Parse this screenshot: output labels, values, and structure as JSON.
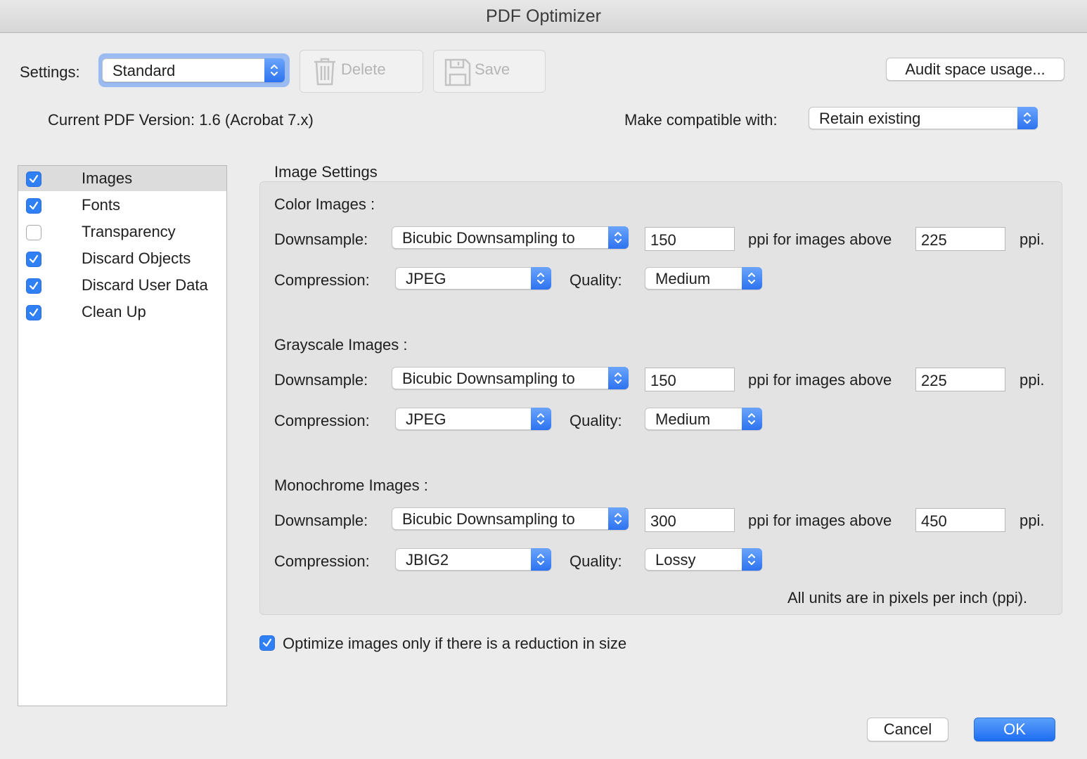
{
  "window": {
    "title": "PDF Optimizer"
  },
  "toolbar": {
    "settings_label": "Settings:",
    "settings_value": "Standard",
    "delete_label": "Delete",
    "save_label": "Save",
    "audit_label": "Audit space usage..."
  },
  "version": {
    "current_text": "Current PDF Version: 1.6 (Acrobat 7.x)",
    "compat_label": "Make compatible with:",
    "compat_value": "Retain existing"
  },
  "panels": [
    {
      "label": "Images",
      "checked": true,
      "selected": true
    },
    {
      "label": "Fonts",
      "checked": true,
      "selected": false
    },
    {
      "label": "Transparency",
      "checked": false,
      "selected": false
    },
    {
      "label": "Discard Objects",
      "checked": true,
      "selected": false
    },
    {
      "label": "Discard User Data",
      "checked": true,
      "selected": false
    },
    {
      "label": "Clean Up",
      "checked": true,
      "selected": false
    }
  ],
  "image_settings": {
    "title": "Image Settings",
    "downsample_label": "Downsample:",
    "compression_label": "Compression:",
    "quality_label": "Quality:",
    "ppi_above_label": "ppi for images above",
    "ppi_end_label": "ppi.",
    "groups": [
      {
        "title": "Color Images :",
        "downsample": "Bicubic Downsampling to",
        "ppi": "150",
        "above": "225",
        "compression": "JPEG",
        "quality": "Medium"
      },
      {
        "title": "Grayscale Images :",
        "downsample": "Bicubic Downsampling to",
        "ppi": "150",
        "above": "225",
        "compression": "JPEG",
        "quality": "Medium"
      },
      {
        "title": "Monochrome Images :",
        "downsample": "Bicubic Downsampling to",
        "ppi": "300",
        "above": "450",
        "compression": "JBIG2",
        "quality": "Lossy"
      }
    ],
    "units_note": "All units are in pixels per inch (ppi)."
  },
  "optimize_only": {
    "label": "Optimize images only if there is a reduction in size",
    "checked": true
  },
  "footer": {
    "cancel_label": "Cancel",
    "ok_label": "OK"
  },
  "colors": {
    "accent": "#2f7ff5",
    "background": "#ececec"
  }
}
